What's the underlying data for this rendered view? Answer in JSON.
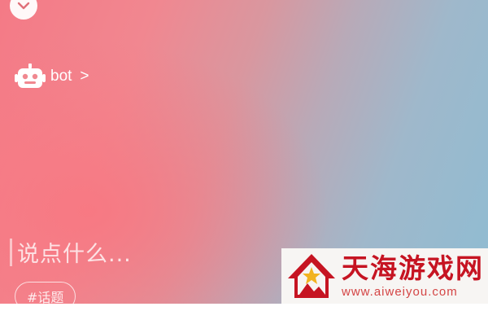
{
  "bot": {
    "label": "bot",
    "chevron": ">"
  },
  "composer": {
    "placeholder": "说点什么..."
  },
  "topic_chip": {
    "label": "#话题"
  },
  "watermark": {
    "title": "天海游戏网",
    "url": "www.aiweiyou.com"
  },
  "icons": {
    "collapse": "chevron-down-icon",
    "bot": "robot-icon"
  },
  "colors": {
    "left": "#f47a86",
    "right": "#8fbcd2",
    "watermark_red": "#c61422"
  }
}
